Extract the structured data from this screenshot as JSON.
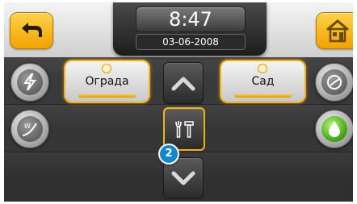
{
  "header": {
    "time": "8:47",
    "date": "03-06-2008"
  },
  "zones": [
    {
      "label": "Ограда"
    },
    {
      "label": "Сад"
    }
  ],
  "badge": {
    "count": "2"
  },
  "icons": {
    "back": "back-arrow-icon",
    "home": "home-icon",
    "left_top": "power-lightning-icon",
    "left_bottom": "sprinkler-icon",
    "right_top": "gauge-icon",
    "right_bottom": "water-drop-icon",
    "up": "chevron-up-icon",
    "settings": "tools-icon",
    "down": "chevron-down-icon"
  },
  "colors": {
    "accent": "#f0b020",
    "badge": "#1487c9",
    "active_drop": "#3aa30f"
  }
}
